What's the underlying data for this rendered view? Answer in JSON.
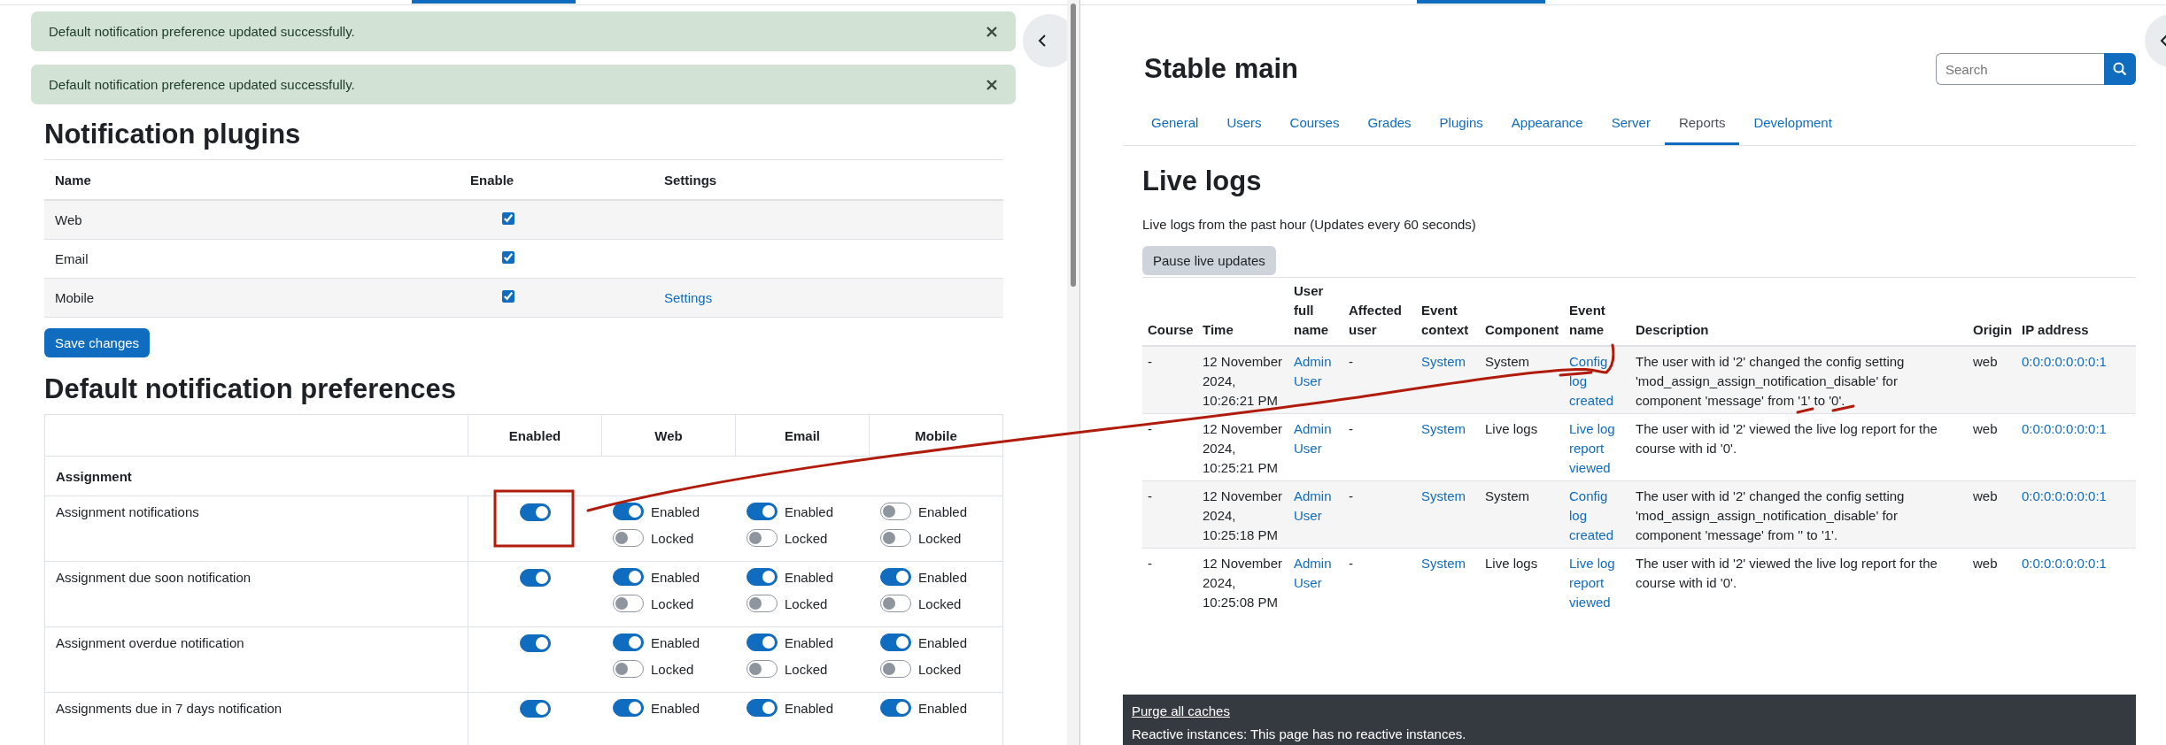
{
  "left_pane": {
    "alerts": [
      {
        "message": "Default notification preference updated successfully."
      },
      {
        "message": "Default notification preference updated successfully."
      }
    ],
    "plugins": {
      "title": "Notification plugins",
      "columns": [
        "Name",
        "Enable",
        "Settings"
      ],
      "rows": [
        {
          "name": "Web",
          "enabled": true
        },
        {
          "name": "Email",
          "enabled": true
        },
        {
          "name": "Mobile",
          "enabled": true,
          "settings": "Settings"
        }
      ]
    },
    "save_button": "Save changes",
    "preferences": {
      "title": "Default notification preferences",
      "columns": [
        "Enabled",
        "Web",
        "Email",
        "Mobile"
      ],
      "groups": [
        {
          "name": "Assignment",
          "items": [
            {
              "name": "Assignment notifications",
              "enabled": true,
              "outputs": [
                {
                  "enabled_label": "Enabled",
                  "enabled": true,
                  "locked_label": "Locked",
                  "locked": false
                },
                {
                  "enabled_label": "Enabled",
                  "enabled": true,
                  "locked_label": "Locked",
                  "locked": false
                },
                {
                  "enabled_label": "Enabled",
                  "enabled": false,
                  "locked_label": "Locked",
                  "locked": false
                }
              ]
            },
            {
              "name": "Assignment due soon notification",
              "enabled": true,
              "outputs": [
                {
                  "enabled_label": "Enabled",
                  "enabled": true,
                  "locked_label": "Locked",
                  "locked": false
                },
                {
                  "enabled_label": "Enabled",
                  "enabled": true,
                  "locked_label": "Locked",
                  "locked": false
                },
                {
                  "enabled_label": "Enabled",
                  "enabled": true,
                  "locked_label": "Locked",
                  "locked": false
                }
              ]
            },
            {
              "name": "Assignment overdue notification",
              "enabled": true,
              "outputs": [
                {
                  "enabled_label": "Enabled",
                  "enabled": true,
                  "locked_label": "Locked",
                  "locked": false
                },
                {
                  "enabled_label": "Enabled",
                  "enabled": true,
                  "locked_label": "Locked",
                  "locked": false
                },
                {
                  "enabled_label": "Enabled",
                  "enabled": true,
                  "locked_label": "Locked",
                  "locked": false
                }
              ]
            },
            {
              "name": "Assignments due in 7 days notification",
              "enabled": true,
              "outputs": [
                {
                  "enabled_label": "Enabled",
                  "enabled": true
                },
                {
                  "enabled_label": "Enabled",
                  "enabled": true
                },
                {
                  "enabled_label": "Enabled",
                  "enabled": true
                }
              ]
            }
          ]
        }
      ]
    }
  },
  "right_pane": {
    "site_title": "Stable main",
    "search": {
      "placeholder": "Search"
    },
    "tabs": [
      {
        "label": "General",
        "selected": false
      },
      {
        "label": "Users",
        "selected": false
      },
      {
        "label": "Courses",
        "selected": false
      },
      {
        "label": "Grades",
        "selected": false
      },
      {
        "label": "Plugins",
        "selected": false
      },
      {
        "label": "Appearance",
        "selected": false
      },
      {
        "label": "Server",
        "selected": false
      },
      {
        "label": "Reports",
        "selected": true
      },
      {
        "label": "Development",
        "selected": false
      }
    ],
    "page_title": "Live logs",
    "intro": "Live logs from the past hour (Updates every 60 seconds)",
    "pause_button": "Pause live updates",
    "table": {
      "columns": [
        {
          "label": "Course",
          "kind": "text"
        },
        {
          "label": "Time",
          "kind": "text"
        },
        {
          "label": "User full name",
          "kind": "link"
        },
        {
          "label": "Affected user",
          "kind": "text"
        },
        {
          "label": "Event context",
          "kind": "link"
        },
        {
          "label": "Component",
          "kind": "text"
        },
        {
          "label": "Event name",
          "kind": "link"
        },
        {
          "label": "Description",
          "kind": "text"
        },
        {
          "label": "Origin",
          "kind": "text"
        },
        {
          "label": "IP address",
          "kind": "link"
        }
      ],
      "rows": [
        [
          "-",
          "12 November 2024, 10:26:21 PM",
          "Admin User",
          "-",
          "System",
          "System",
          "Config log created",
          "The user with id '2' changed the config setting 'mod_assign_assign_notification_disable' for component 'message' from '1' to '0'.",
          "web",
          "0:0:0:0:0:0:0:1"
        ],
        [
          "-",
          "12 November 2024, 10:25:21 PM",
          "Admin User",
          "-",
          "System",
          "Live logs",
          "Live log report viewed",
          "The user with id '2' viewed the live log report for the course with id '0'.",
          "web",
          "0:0:0:0:0:0:0:1"
        ],
        [
          "-",
          "12 November 2024, 10:25:18 PM",
          "Admin User",
          "-",
          "System",
          "System",
          "Config log created",
          "The user with id '2' changed the config setting 'mod_assign_assign_notification_disable' for component 'message' from '' to '1'.",
          "web",
          "0:0:0:0:0:0:0:1"
        ],
        [
          "-",
          "12 November 2024, 10:25:08 PM",
          "Admin User",
          "-",
          "System",
          "Live logs",
          "Live log report viewed",
          "The user with id '2' viewed the live log report for the course with id '0'.",
          "web",
          "0:0:0:0:0:0:0:1"
        ]
      ]
    },
    "footer": {
      "link": "Purge all caches",
      "text": "Reactive instances: This page has no reactive instances."
    }
  }
}
